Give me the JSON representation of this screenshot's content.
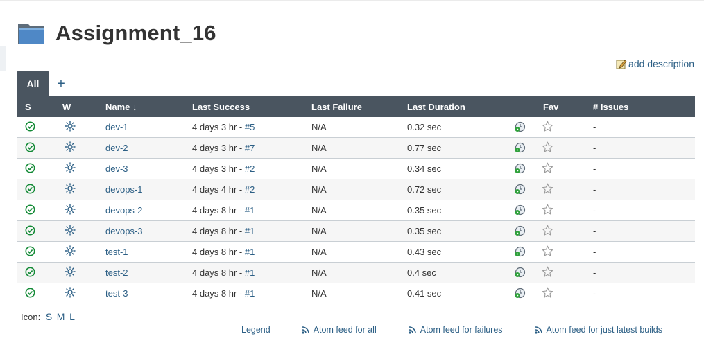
{
  "page": {
    "title": "Assignment_16",
    "add_description": "add description"
  },
  "tabs": [
    {
      "label": "All",
      "active": true
    },
    {
      "label": "+"
    }
  ],
  "table": {
    "headers": {
      "s": "S",
      "w": "W",
      "name": "Name ↓",
      "last_success": "Last Success",
      "last_failure": "Last Failure",
      "last_duration": "Last Duration",
      "fav": "Fav",
      "issues": "# Issues"
    },
    "rows": [
      {
        "name": "dev-1",
        "last_success": "4 days 3 hr - ",
        "build": "#5",
        "last_failure": "N/A",
        "last_duration": "0.32 sec",
        "issues": "-"
      },
      {
        "name": "dev-2",
        "last_success": "4 days 3 hr - ",
        "build": "#7",
        "last_failure": "N/A",
        "last_duration": "0.77 sec",
        "issues": "-"
      },
      {
        "name": "dev-3",
        "last_success": "4 days 3 hr - ",
        "build": "#2",
        "last_failure": "N/A",
        "last_duration": "0.34 sec",
        "issues": "-"
      },
      {
        "name": "devops-1",
        "last_success": "4 days 4 hr - ",
        "build": "#2",
        "last_failure": "N/A",
        "last_duration": "0.72 sec",
        "issues": "-"
      },
      {
        "name": "devops-2",
        "last_success": "4 days 8 hr - ",
        "build": "#1",
        "last_failure": "N/A",
        "last_duration": "0.35 sec",
        "issues": "-"
      },
      {
        "name": "devops-3",
        "last_success": "4 days 8 hr - ",
        "build": "#1",
        "last_failure": "N/A",
        "last_duration": "0.35 sec",
        "issues": "-"
      },
      {
        "name": "test-1",
        "last_success": "4 days 8 hr - ",
        "build": "#1",
        "last_failure": "N/A",
        "last_duration": "0.43 sec",
        "issues": "-"
      },
      {
        "name": "test-2",
        "last_success": "4 days 8 hr - ",
        "build": "#1",
        "last_failure": "N/A",
        "last_duration": "0.4 sec",
        "issues": "-"
      },
      {
        "name": "test-3",
        "last_success": "4 days 8 hr - ",
        "build": "#1",
        "last_failure": "N/A",
        "last_duration": "0.41 sec",
        "issues": "-"
      }
    ]
  },
  "icons": {
    "status": "success-check-icon",
    "weather": "sunny-weather-icon",
    "action": "schedule-build-icon",
    "fav": "star-outline-icon",
    "folder": "folder-icon",
    "edit": "edit-note-icon",
    "feed": "rss-feed-icon"
  },
  "colors": {
    "header_bg": "#4a5560",
    "link": "#2c5f85",
    "success": "#138a36"
  },
  "footer": {
    "icon_label": "Icon:",
    "sizes": [
      "S",
      "M",
      "L"
    ],
    "legend": "Legend",
    "feed_all": "Atom feed for all",
    "feed_failures": "Atom feed for failures",
    "feed_latest": "Atom feed for just latest builds"
  }
}
